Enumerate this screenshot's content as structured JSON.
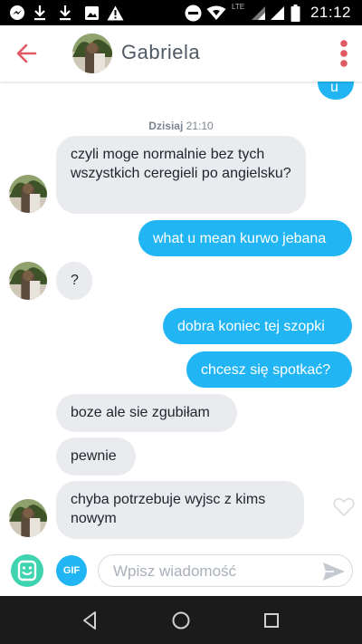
{
  "status_bar": {
    "time": "21:12",
    "network": "LTE",
    "icons": [
      "messenger-icon",
      "download-icon",
      "download-icon",
      "image-icon",
      "warning-icon",
      "do-not-disturb-icon",
      "wifi-icon",
      "signal-icon",
      "signal-icon",
      "battery-icon"
    ]
  },
  "header": {
    "contact_name": "Gabriela",
    "accent_color": "#e05a64"
  },
  "chat": {
    "date_label_day": "Dzisiaj",
    "date_label_time": "21:10",
    "partial_top_message": "u",
    "messages": [
      {
        "side": "in",
        "text": "czyli moge normalnie bez tych wszystkich ceregieli po angielsku?"
      },
      {
        "side": "out",
        "text": "what u mean kurwo jebana"
      },
      {
        "side": "in",
        "text": "?"
      },
      {
        "side": "out",
        "text": "dobra koniec tej szopki"
      },
      {
        "side": "out",
        "text": "chcesz się spotkać?"
      },
      {
        "side": "in",
        "text": "boze ale sie zgubiłam"
      },
      {
        "side": "in",
        "text": "pewnie"
      },
      {
        "side": "in",
        "text": "chyba potrzebuje wyjsc z kims nowym"
      }
    ],
    "incoming_color": "#e9ebee",
    "outgoing_color": "#22b5f3"
  },
  "composer": {
    "placeholder": "Wpisz wiadomość",
    "gif_label": "GIF"
  },
  "nav": {
    "buttons": [
      "back-triangle-icon",
      "home-circle-icon",
      "recents-square-icon"
    ]
  }
}
